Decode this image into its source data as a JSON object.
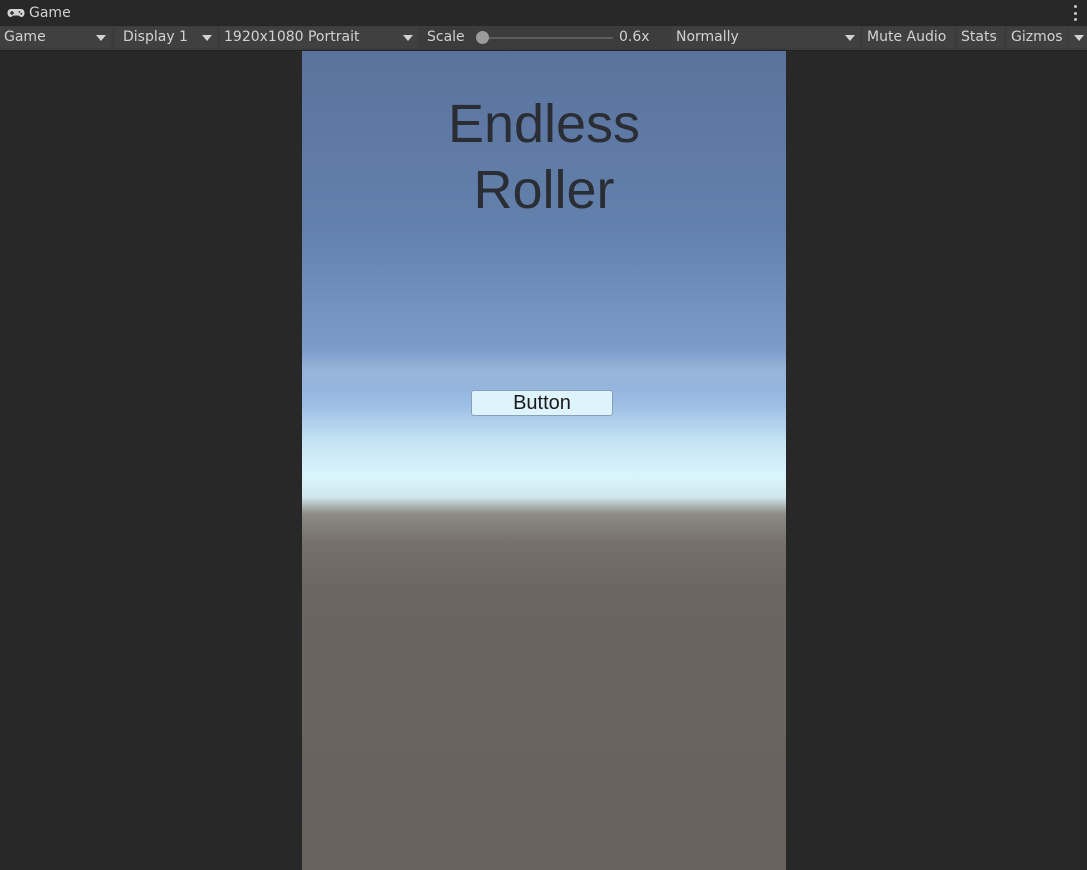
{
  "tab": {
    "icon": "gamepad-icon",
    "label": "Game"
  },
  "toolbar": {
    "view_mode": "Game",
    "display": "Display 1",
    "resolution": "1920x1080 Portrait",
    "scale_label": "Scale",
    "scale_value": "0.6x",
    "scale_level": 0.0,
    "play_mode": "Normally",
    "mute_audio": "Mute Audio",
    "stats": "Stats",
    "gizmos": "Gizmos",
    "more_icon": "kebab-menu-icon"
  },
  "game": {
    "title_line1": "Endless",
    "title_line2": "Roller",
    "button_label": "Button",
    "colors": {
      "sky_top": "#5a739c",
      "horizon": "#dbf5fd",
      "ground": "#67625d",
      "title_text": "#2a2d33",
      "button_bg": "#def4fc"
    }
  }
}
